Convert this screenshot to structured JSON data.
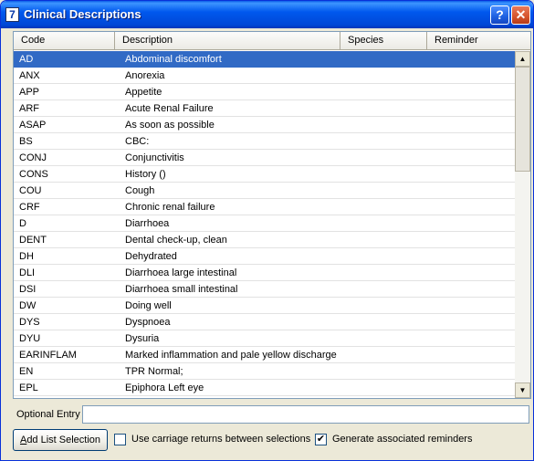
{
  "window": {
    "title": "Clinical Descriptions",
    "icon_char": "7",
    "help_glyph": "?",
    "close_glyph": "✕"
  },
  "list": {
    "columns": [
      "Code",
      "Description",
      "Species",
      "Reminder"
    ],
    "rows": [
      {
        "code": "AD",
        "description": "Abdominal discomfort",
        "selected": true
      },
      {
        "code": "ANX",
        "description": "Anorexia"
      },
      {
        "code": "APP",
        "description": "Appetite"
      },
      {
        "code": "ARF",
        "description": "Acute Renal Failure"
      },
      {
        "code": "ASAP",
        "description": "As soon as possible"
      },
      {
        "code": "BS",
        "description": "CBC:"
      },
      {
        "code": "CONJ",
        "description": "Conjunctivitis"
      },
      {
        "code": "CONS",
        "description": "History ()"
      },
      {
        "code": "COU",
        "description": "Cough"
      },
      {
        "code": "CRF",
        "description": "Chronic renal failure"
      },
      {
        "code": "D",
        "description": "Diarrhoea"
      },
      {
        "code": "DENT",
        "description": "Dental check-up, clean"
      },
      {
        "code": "DH",
        "description": "Dehydrated"
      },
      {
        "code": "DLI",
        "description": "Diarrhoea large intestinal"
      },
      {
        "code": "DSI",
        "description": "Diarrhoea small intestinal"
      },
      {
        "code": "DW",
        "description": "Doing well"
      },
      {
        "code": "DYS",
        "description": "Dyspnoea"
      },
      {
        "code": "DYU",
        "description": "Dysuria"
      },
      {
        "code": "EARINFLAM",
        "description": "Marked inflammation and pale yellow discharge"
      },
      {
        "code": "EN",
        "description": "TPR Normal;"
      },
      {
        "code": "EPL",
        "description": "Epiphora Left eye"
      }
    ],
    "selected_color": "#316ac5"
  },
  "optional_entry": {
    "label": "Optional Entry",
    "value": ""
  },
  "footer": {
    "add_button_label": "Add List Selection",
    "carriage_returns": {
      "label": "Use carriage returns between selections",
      "checked": false
    },
    "generate_reminders": {
      "label": "Generate associated reminders",
      "checked": true
    }
  },
  "icons": {
    "scroll_up": "up-arrow-icon",
    "scroll_down": "down-arrow-icon",
    "check": "checkmark-icon"
  }
}
